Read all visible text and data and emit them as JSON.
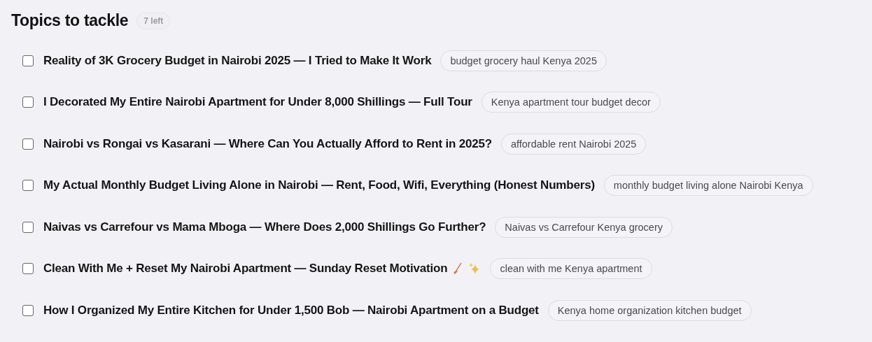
{
  "header": {
    "title": "Topics to tackle",
    "count": "7 left"
  },
  "topics": [
    {
      "title": "Reality of 3K Grocery Budget in Nairobi 2025 — I Tried to Make It Work",
      "tag": "budget grocery haul Kenya 2025",
      "checked": false,
      "emoji": false
    },
    {
      "title": "I Decorated My Entire Nairobi Apartment for Under 8,000 Shillings — Full Tour",
      "tag": "Kenya apartment tour budget decor",
      "checked": false,
      "emoji": false
    },
    {
      "title": "Nairobi vs Rongai vs Kasarani — Where Can You Actually Afford to Rent in 2025?",
      "tag": "affordable rent Nairobi 2025",
      "checked": false,
      "emoji": false
    },
    {
      "title": "My Actual Monthly Budget Living Alone in Nairobi — Rent, Food, Wifi, Everything (Honest Numbers)",
      "tag": "monthly budget living alone Nairobi Kenya",
      "checked": false,
      "emoji": false
    },
    {
      "title": "Naivas vs Carrefour vs Mama Mboga — Where Does 2,000 Shillings Go Further?",
      "tag": "Naivas vs Carrefour Kenya grocery",
      "checked": false,
      "emoji": false
    },
    {
      "title": "Clean With Me + Reset My Nairobi Apartment — Sunday Reset Motivation",
      "tag": "clean with me Kenya apartment",
      "checked": false,
      "emoji": true
    },
    {
      "title": "How I Organized My Entire Kitchen for Under 1,500 Bob — Nairobi Apartment on a Budget",
      "tag": "Kenya home organization kitchen budget",
      "checked": false,
      "emoji": false
    }
  ]
}
